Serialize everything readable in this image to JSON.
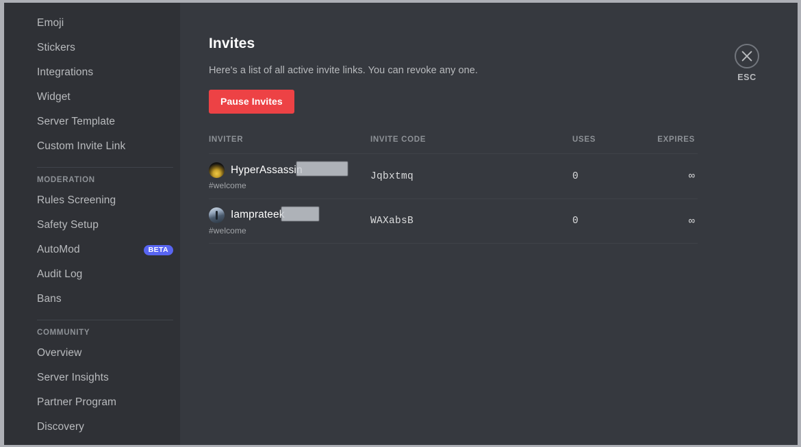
{
  "colors": {
    "sidebar_bg": "#2f3136",
    "main_bg": "#36393f",
    "accent_danger": "#ed4245",
    "accent_blurple": "#5865f2",
    "text_muted": "#b9bbbe",
    "divider": "#3f4248"
  },
  "sidebar": {
    "items_top": [
      {
        "label": "Emoji"
      },
      {
        "label": "Stickers"
      },
      {
        "label": "Integrations"
      },
      {
        "label": "Widget"
      },
      {
        "label": "Server Template"
      },
      {
        "label": "Custom Invite Link"
      }
    ],
    "section_moderation": {
      "heading": "MODERATION",
      "items": [
        {
          "label": "Rules Screening",
          "badge": ""
        },
        {
          "label": "Safety Setup",
          "badge": ""
        },
        {
          "label": "AutoMod",
          "badge": "BETA"
        },
        {
          "label": "Audit Log",
          "badge": ""
        },
        {
          "label": "Bans",
          "badge": ""
        }
      ]
    },
    "section_community": {
      "heading": "COMMUNITY",
      "items": [
        {
          "label": "Overview"
        },
        {
          "label": "Server Insights"
        },
        {
          "label": "Partner Program"
        },
        {
          "label": "Discovery"
        }
      ]
    }
  },
  "main": {
    "title": "Invites",
    "description": "Here's a list of all active invite links. You can revoke any one.",
    "pause_button": "Pause Invites",
    "table": {
      "headers": {
        "inviter": "INVITER",
        "code": "INVITE CODE",
        "uses": "USES",
        "expires": "EXPIRES"
      },
      "rows": [
        {
          "inviter_name": "HyperAssassin",
          "inviter_redacted": true,
          "channel": "#welcome",
          "code": "Jqbxtmq",
          "uses": "0",
          "expires": "∞",
          "avatar": "avatar-gold-crest"
        },
        {
          "inviter_name": "Iamprateek",
          "inviter_redacted": true,
          "channel": "#welcome",
          "code": "WAXabsB",
          "uses": "0",
          "expires": "∞",
          "avatar": "avatar-blue-landscape"
        }
      ]
    }
  },
  "close": {
    "icon": "close-x-icon",
    "label": "ESC"
  }
}
